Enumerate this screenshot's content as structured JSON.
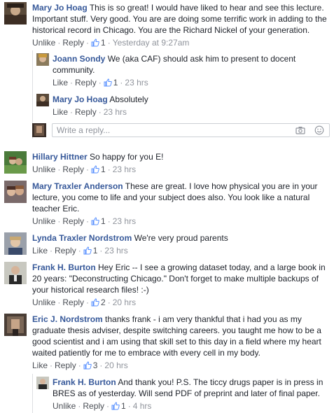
{
  "actions": {
    "like": "Like",
    "unlike": "Unlike",
    "reply": "Reply"
  },
  "comments": [
    {
      "author": "Mary Jo Hoag",
      "text": "This is so great! I would have liked to hear and see this lecture. Important stuff. Very good. You are are doing some terrific work in adding to the historical record in Chicago. You are the Richard Nickel of your generation.",
      "likes": "1",
      "time": "Yesterday at 9:27am"
    },
    {
      "author": "Joann Sondy",
      "text": "We (aka CAF) should ask him to present to docent community.",
      "likes": "1",
      "time": "23 hrs"
    },
    {
      "author": "Mary Jo Hoag",
      "text": "Absolutely",
      "time": "23 hrs"
    },
    {
      "author": "Hillary Hittner",
      "text": "So happy for you E!",
      "likes": "1",
      "time": "23 hrs"
    },
    {
      "author": "Mary Traxler Anderson",
      "text": "These are great. I love how physical you are in your lecture, you come to life and your subject does also. You look like a natural teacher Eric.",
      "likes": "1",
      "time": "23 hrs"
    },
    {
      "author": "Lynda Traxler Nordstrom",
      "text": "We're very proud parents",
      "likes": "1",
      "time": "23 hrs"
    },
    {
      "author": "Frank H. Burton",
      "text": "Hey Eric -- I see a growing dataset today, and a large book in 20  years: \"Deconstructing Chicago.\" Don't forget to make multiple backups of your historical research files! :-)",
      "likes": "2",
      "time": "20 hrs"
    },
    {
      "author": "Eric J. Nordstrom",
      "text": "thanks frank - i am very thankful that i had you as my graduate thesis adviser, despite switching careers. you taught me how to be a good scientist and i am using that skill set to this day in a field where my heart waited patiently for me to embrace with every cell in my body.",
      "likes": "3",
      "time": "20 hrs"
    },
    {
      "author": "Frank H. Burton",
      "text": "And thank you! P.S. The ticcy drugs paper is in press in BRES as of yesterday. Will send PDF of preprint and later of final paper.",
      "likes": "1",
      "time": "4 hrs"
    }
  ],
  "reply_box": {
    "placeholder": "Write a reply..."
  },
  "icons": {
    "camera": "camera-icon",
    "emoji": "emoji-icon",
    "thumb": "thumbs-up-icon"
  },
  "colors": {
    "author": "#365899",
    "link": "#4b4f56",
    "meta": "#90949c",
    "like_icon": "#5890ff"
  }
}
